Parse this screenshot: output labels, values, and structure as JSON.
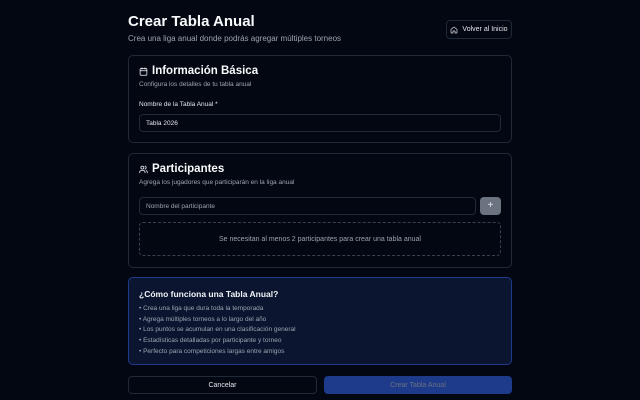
{
  "header": {
    "title": "Crear Tabla Anual",
    "subtitle": "Crea una liga anual donde podrás agregar múltiples torneos",
    "back_label": "Volver al Inicio"
  },
  "basic": {
    "title": "Información Básica",
    "description": "Configura los detalles de tu tabla anual",
    "name_label": "Nombre de la Tabla Anual *",
    "name_value": "Tabla 2026"
  },
  "participants": {
    "title": "Participantes",
    "description": "Agrega los jugadores que participarán en la liga anual",
    "input_placeholder": "Nombre del participante",
    "add_label": "+",
    "empty_message": "Se necesitan al menos 2 participantes para crear una tabla anual"
  },
  "info": {
    "title": "¿Cómo funciona una Tabla Anual?",
    "items": [
      "• Crea una liga que dura toda la temporada",
      "• Agrega múltiples torneos a lo largo del año",
      "• Los puntos se acumulan en una clasificación general",
      "• Estadísticas detalladas por participante y torneo",
      "• Perfecto para competiciones largas entre amigos"
    ]
  },
  "actions": {
    "cancel_label": "Cancelar",
    "create_label": "Crear Tabla Anual"
  },
  "icons": {
    "back": "home-icon",
    "basic": "calendar-icon",
    "participants": "users-icon"
  },
  "colors": {
    "background": "#030712",
    "border": "#1f2937",
    "primary_disabled": "#1e3a8a",
    "info_border": "#1e3a8a"
  }
}
